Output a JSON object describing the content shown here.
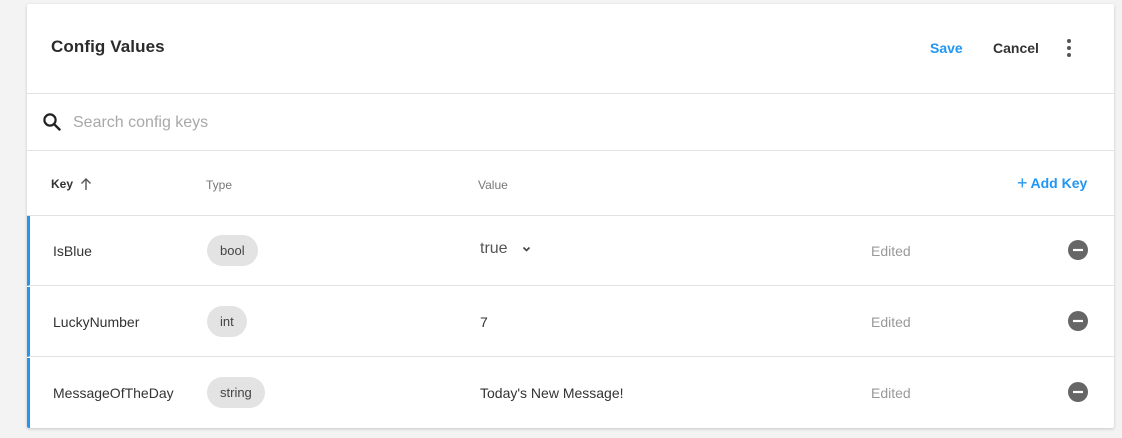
{
  "header": {
    "title": "Config Values",
    "save_label": "Save",
    "cancel_label": "Cancel",
    "more_icon": "more-vertical-icon"
  },
  "search": {
    "placeholder": "Search config keys",
    "value": "",
    "icon": "search-icon"
  },
  "table": {
    "columns": {
      "key": "Key",
      "type": "Type",
      "value": "Value"
    },
    "sort": {
      "column": "Key",
      "direction": "ascending",
      "icon": "arrow-up-icon"
    },
    "add_key_label": "Add Key",
    "add_key_icon": "+",
    "rows": [
      {
        "key": "IsBlue",
        "type": "bool",
        "value": "true",
        "status": "Edited"
      },
      {
        "key": "LuckyNumber",
        "type": "int",
        "value": "7",
        "status": "Edited"
      },
      {
        "key": "MessageOfTheDay",
        "type": "string",
        "value": "Today's New Message!",
        "status": "Edited"
      }
    ],
    "remove_icon": "remove-circle-icon"
  },
  "colors": {
    "accent": "#2196f3",
    "background": "#f3f3f3",
    "pill": "#e3e3e3",
    "status_text": "#999999"
  }
}
